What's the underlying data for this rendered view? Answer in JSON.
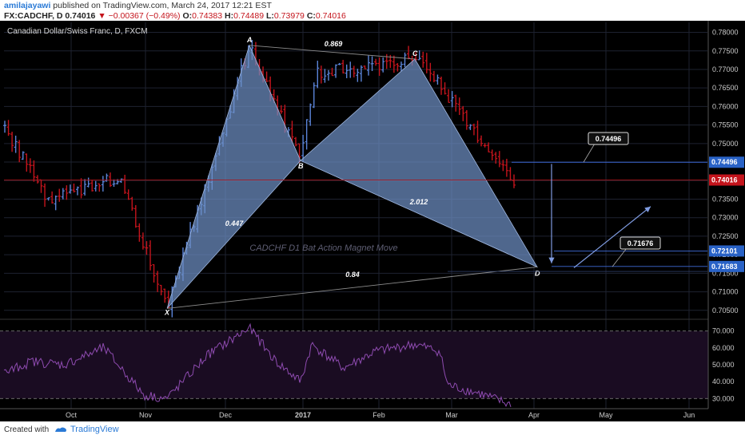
{
  "header": {
    "author": "amilajayawi",
    "published_text": "published on TradingView.com, March 24, 2017 12:21 EST",
    "symbol": "FX:CADCHF, D",
    "last": "0.74016",
    "change": "▼ −0.00367 (−0.49%)",
    "o_label": "O:",
    "o_val": "0.74383",
    "h_label": "H:",
    "h_val": "0.74489",
    "l_label": "L:",
    "l_val": "0.73979",
    "c_label": "C:",
    "c_val": "0.74016"
  },
  "footer": {
    "created_with": "Created with",
    "brand": "TradingView"
  },
  "colors": {
    "up": "#5b84d8",
    "down": "#c4141c",
    "pattern_fill": "#6d8fc4",
    "rsi": "#8e4bb0",
    "price_tag_red": "#c4141c",
    "price_tag_blue": "#2962c6"
  },
  "chart_data": [
    {
      "type": "ohlc",
      "title": "Canadian Dollar/Swiss Franc, D, FXCM",
      "y_ticks": [
        "0.78000",
        "0.77500",
        "0.77000",
        "0.76500",
        "0.76000",
        "0.75500",
        "0.75000",
        "0.74500",
        "0.74000",
        "0.73500",
        "0.73000",
        "0.72500",
        "0.72000",
        "0.71500",
        "0.71000",
        "0.70500"
      ],
      "ylim": [
        0.7028,
        0.7827
      ],
      "x_ticks": [
        "Oct",
        "Nov",
        "Dec",
        "2017",
        "Feb",
        "Mar",
        "Apr",
        "May",
        "Jun"
      ],
      "grid": true,
      "price_tags": [
        {
          "label": "0.74496",
          "value": 0.74496,
          "color": "blue"
        },
        {
          "label": "0.74016",
          "value": 0.74016,
          "color": "red"
        },
        {
          "label": "0.72101",
          "value": 0.72101,
          "color": "blue"
        },
        {
          "label": "0.71683",
          "value": 0.71683,
          "color": "blue"
        }
      ],
      "pattern": {
        "name": "CADCHF D1 Bat Action Magnet Move",
        "points": [
          {
            "label": "X",
            "value": 0.7055
          },
          {
            "label": "A",
            "value": 0.7765
          },
          {
            "label": "B",
            "value": 0.7454
          },
          {
            "label": "C",
            "value": 0.7728
          },
          {
            "label": "D",
            "value": 0.7167
          }
        ],
        "ratios": [
          {
            "label": "0.447",
            "between": "XB"
          },
          {
            "label": "0.869",
            "between": "AC"
          },
          {
            "label": "2.012",
            "between": "BD"
          },
          {
            "label": "0.84",
            "between": "XD"
          }
        ]
      },
      "callouts": [
        {
          "label": "0.74496",
          "value": 0.74496
        },
        {
          "label": "0.71676",
          "value": 0.71676
        }
      ]
    },
    {
      "type": "line",
      "title": "",
      "y_ticks": [
        "70.000",
        "60.000",
        "50.000",
        "40.000",
        "30.000"
      ],
      "ylim": [
        24,
        76
      ],
      "bands": [
        70,
        30
      ],
      "x_ticks": [
        "Oct",
        "Nov",
        "Dec",
        "2017",
        "Feb",
        "Mar",
        "Apr",
        "May",
        "Jun"
      ]
    }
  ]
}
